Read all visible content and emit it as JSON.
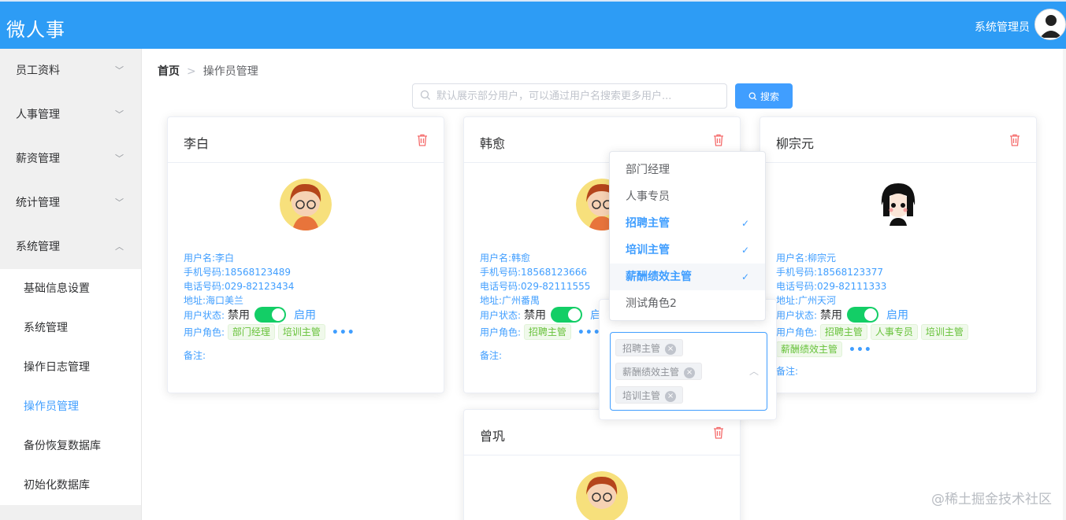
{
  "header": {
    "title": "微人事",
    "user_name": "系统管理员"
  },
  "sidebar": {
    "menus": [
      {
        "label": "员工资料"
      },
      {
        "label": "人事管理"
      },
      {
        "label": "薪资管理"
      },
      {
        "label": "统计管理"
      },
      {
        "label": "系统管理"
      }
    ],
    "submenu": [
      {
        "label": "基础信息设置"
      },
      {
        "label": "系统管理"
      },
      {
        "label": "操作日志管理"
      },
      {
        "label": "操作员管理"
      },
      {
        "label": "备份恢复数据库"
      },
      {
        "label": "初始化数据库"
      }
    ]
  },
  "breadcrumb": {
    "home": "首页",
    "current": "操作员管理"
  },
  "search": {
    "placeholder": "默认展示部分用户，可以通过用户名搜索更多用户...",
    "button": "搜索"
  },
  "labels": {
    "status_prefix": "用户状态:",
    "disabled": "禁用",
    "enabled": "启用",
    "roles_prefix": "用户角色:",
    "remark": "备注:"
  },
  "cards": [
    {
      "name": "李白",
      "username": "用户名:李白",
      "mobile": "手机号码:18568123489",
      "phone": "电话号码:029-82123434",
      "address": "地址:海口美兰",
      "roles": [
        "部门经理",
        "培训主管"
      ]
    },
    {
      "name": "韩愈",
      "username": "用户名:韩愈",
      "mobile": "手机号码:18568123666",
      "phone": "电话号码:029-82111555",
      "address": "地址:广州番禺",
      "roles": [
        "招聘主管"
      ]
    },
    {
      "name": "柳宗元",
      "username": "用户名:柳宗元",
      "mobile": "手机号码:18568123377",
      "phone": "电话号码:029-82111333",
      "address": "地址:广州天河",
      "roles": [
        "招聘主管",
        "人事专员",
        "培训主管",
        "薪酬绩效主管"
      ]
    },
    {
      "name": "曾巩"
    }
  ],
  "dropdown": {
    "options": [
      {
        "label": "部门经理",
        "selected": false
      },
      {
        "label": "人事专员",
        "selected": false
      },
      {
        "label": "招聘主管",
        "selected": true
      },
      {
        "label": "培训主管",
        "selected": true
      },
      {
        "label": "薪酬绩效主管",
        "selected": true
      },
      {
        "label": "测试角色2",
        "selected": false
      }
    ],
    "check": "✓"
  },
  "selected_tags": [
    "招聘主管",
    "薪酬绩效主管",
    "培训主管"
  ],
  "watermark": "@稀土掘金技术社区",
  "colors": {
    "header": "#2d9cf5",
    "accent": "#409eff",
    "switch_on": "#13ce66",
    "tag_green": "#67c23a",
    "danger": "#f56c6c"
  }
}
